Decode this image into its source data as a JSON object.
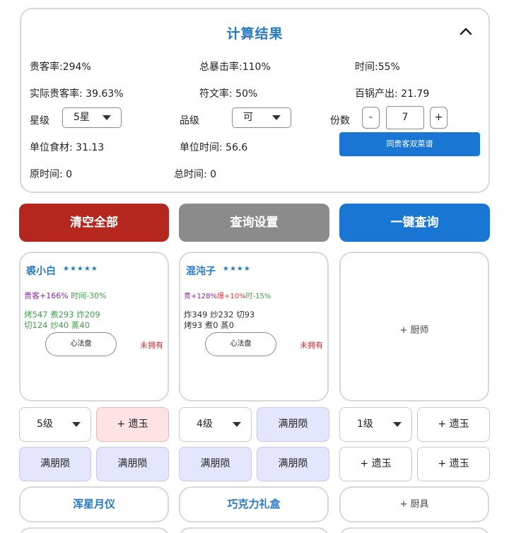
{
  "panel": {
    "title": "计算结果",
    "stats": {
      "guest_rate": "贵客率:294%",
      "crit_rate": "总暴击率:110%",
      "time": "时间:55%",
      "actual_guest_rate": "实际贵客率: 39.63%",
      "rune_rate": "符文率: 50%",
      "hundred_pot": "百锅产出: 21.79",
      "unit_ingredient": "单位食材: 31.13",
      "unit_time": "单位时间: 56.6",
      "original_time": "原时间: 0",
      "total_time": "总时间: 0"
    },
    "star_label": "星级",
    "star_value": "5星",
    "quality_label": "品级",
    "quality_value": "可",
    "copies_label": "份数",
    "copies_minus": "-",
    "copies_value": "7",
    "copies_plus": "+",
    "same_guest_button": "同贵客双菜谱"
  },
  "actions": {
    "clear_all": "清空全部",
    "query_settings": "查询设置",
    "one_click_query": "一键查询"
  },
  "colors": {
    "clear_all": "#b5261e",
    "query_settings": "#8b8b8b",
    "one_click_query": "#1976d2",
    "title_blue": "#2a7ac0"
  },
  "chefs": [
    {
      "name": "裘小白",
      "stars": "★★★★★",
      "effect_a": "贵客+166%",
      "effect_b": " 时间-30%",
      "skills_line1": "烤547 煮293 炸209",
      "skills_line2": "切124 炒40 蒸40",
      "xinfa": "心法盘",
      "status": "未拥有"
    },
    {
      "name": "混沌子",
      "stars": "★★★★",
      "effect_a": "贵+128%",
      "effect_b": "爆+10%",
      "effect_c": "时-15%",
      "skills_line1": "炸349 炒232 切93",
      "skills_line2": "烤93 煮0 蒸0",
      "xinfa": "心法盘",
      "status": "未拥有"
    },
    {
      "add_label": "+ 厨师"
    }
  ],
  "equip": {
    "col1": {
      "level": "5级",
      "relic": "+ 遗玉",
      "slot_a": "满朋陨",
      "slot_b": "满朋陨",
      "tool": "浑星月仪"
    },
    "col2": {
      "level": "4级",
      "relic": "满朋陨",
      "slot_a": "满朋陨",
      "slot_b": "满朋陨",
      "tool": "巧克力礼盒"
    },
    "col3": {
      "level": "1级",
      "relic": "+ 遗玉",
      "slot_a": "+ 遗玉",
      "slot_b": "+ 遗玉",
      "tool": "+ 厨具"
    }
  }
}
